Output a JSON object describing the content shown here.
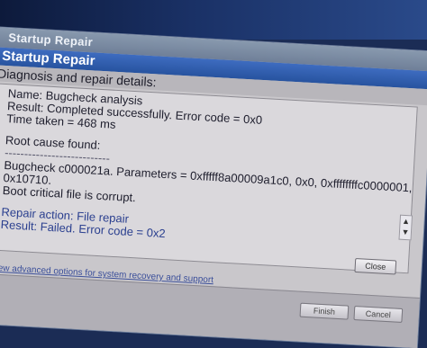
{
  "window": {
    "title": "Startup Repair"
  },
  "header": {
    "title": "Startup Repair"
  },
  "details": {
    "label": "Diagnosis and repair details:",
    "lines": [
      "Name: Bugcheck analysis",
      "Result: Completed successfully. Error code = 0x0",
      "Time taken = 468 ms",
      "Root cause found:",
      "---------------------------",
      "Bugcheck c000021a. Parameters = 0xfffff8a00009a1c0, 0x0, 0xffffffffc0000001,",
      "0x10710.",
      "Boot critical file  is corrupt.",
      "Repair action: File repair",
      "Result: Failed. Error code = 0x2"
    ]
  },
  "scrollbar": {
    "up": "▲",
    "down": "▼"
  },
  "buttons": {
    "close": "Close",
    "finish": "Finish",
    "cancel": "Cancel"
  },
  "links": {
    "advanced": "View advanced options for system recovery and support"
  }
}
